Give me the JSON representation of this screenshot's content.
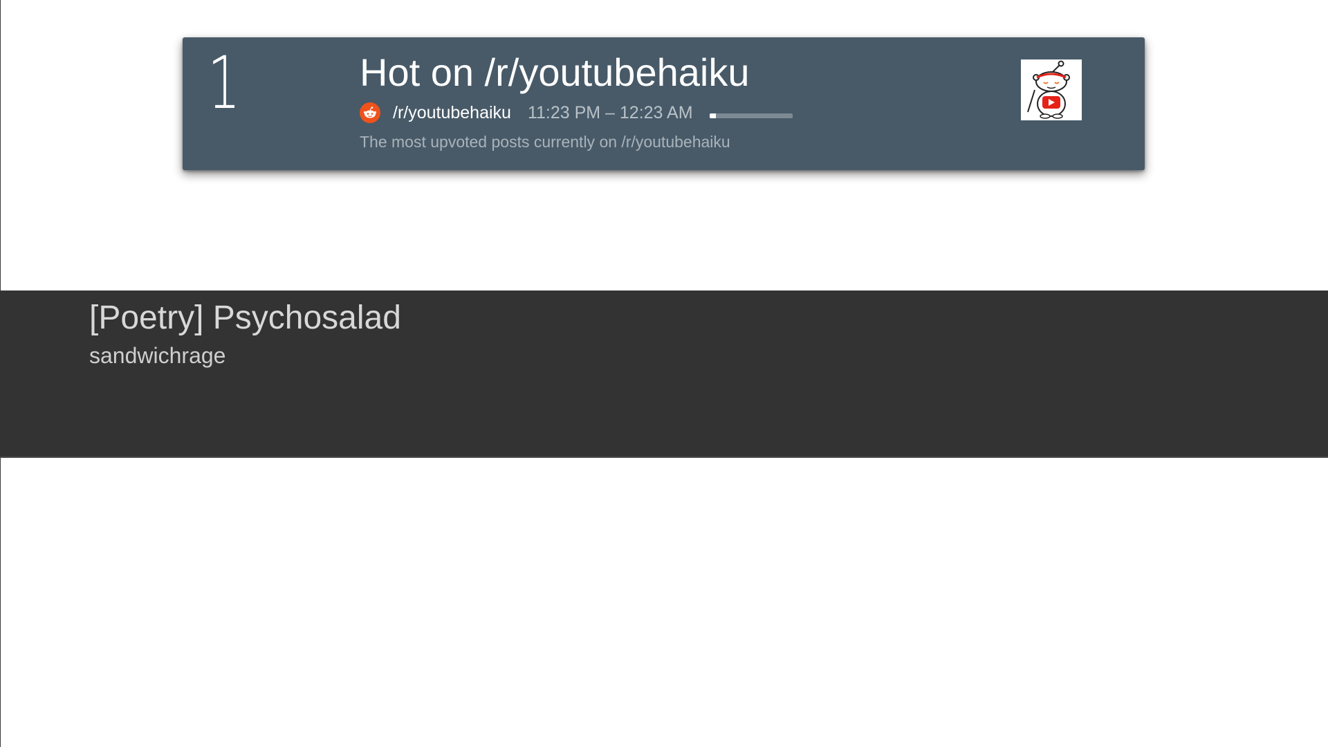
{
  "program": {
    "channel_number": "1",
    "title": "Hot on /r/youtubehaiku",
    "channel_name": "/r/youtubehaiku",
    "time_range": "11:23 PM – 12:23 AM",
    "progress": 0.08,
    "description": "The most upvoted posts currently on /r/youtubehaiku",
    "channel_icon": "reddit-alien-icon",
    "thumbnail_icon": "reddit-snoo-youtube-icon"
  },
  "post": {
    "title": "[Poetry] Psychosalad",
    "author": "sandwichrage"
  },
  "colors": {
    "card_background": "#485a68",
    "panel_background": "#333333",
    "reddit_orange": "#f0521b",
    "youtube_red": "#e62117"
  }
}
